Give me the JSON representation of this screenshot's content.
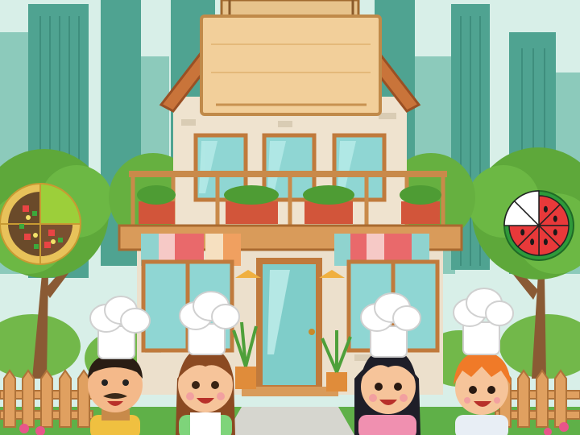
{
  "scene": {
    "type": "cartoon restaurant game screen",
    "sign_text": "",
    "colors": {
      "sky": "#d8efe8",
      "city_far": "#7cc2b0",
      "city_near": "#4fa391",
      "house_wall": "#efe3cf",
      "roof": "#c9743a",
      "window": "#8fd6d3",
      "door": "#7fcdc9",
      "sign_wood": "#f2cf9a",
      "balcony_wood": "#c98a4a",
      "fence": "#e0a060",
      "grass": "#5fb048",
      "tree_leaf": "#5ea83a",
      "trunk": "#8a5a34",
      "awning_red": "#e9696b",
      "awning_teal": "#8fd3cf",
      "chef_hat": "#ffffff"
    }
  },
  "fraction_pizza": {
    "label": "pizza-fraction",
    "slices_total": 4,
    "slices_shown": 3,
    "slices_missing_color": "#9ccf3a"
  },
  "fraction_watermelon": {
    "label": "watermelon-fraction",
    "slices_total": 8,
    "slices_shown": 6
  },
  "chefs": [
    {
      "name": "chef-man-mustache",
      "hair": "#2a1d14",
      "shirt": "#f0c040"
    },
    {
      "name": "chef-girl-brown-hair",
      "hair": "#8b4a22",
      "shirt": "#7ed47a"
    },
    {
      "name": "chef-girl-black-hair",
      "hair": "#1e1e28",
      "shirt": "#f090b0"
    },
    {
      "name": "chef-boy-orange-hair",
      "hair": "#f07a28",
      "shirt": "#e8eef5"
    }
  ]
}
